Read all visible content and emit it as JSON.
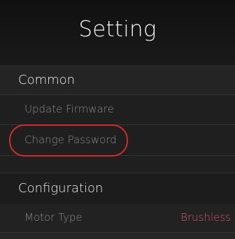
{
  "header": {
    "title": "Setting"
  },
  "sections": {
    "common": {
      "label": "Common",
      "items": [
        {
          "label": "Update Firmware"
        },
        {
          "label": "Change Password"
        }
      ]
    },
    "configuration": {
      "label": "Configuration",
      "items": [
        {
          "label": "Motor Type",
          "value": "Brushless"
        }
      ]
    }
  },
  "colors": {
    "background": "#1b1b1b",
    "value_text": "#d05a6a",
    "highlight_ring": "#d42a2a"
  }
}
